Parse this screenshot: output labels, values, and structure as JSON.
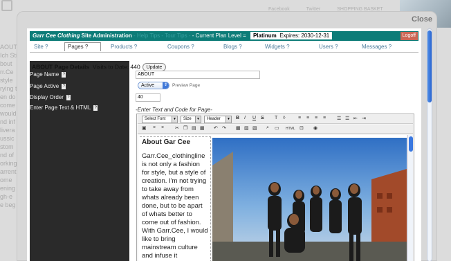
{
  "background": {
    "links": [
      "Facebook",
      "Twitter",
      "SHOPPING BASKET"
    ],
    "left_text": [
      "AOUT",
      "Ich Sti",
      "",
      "bout",
      "rr.Ce",
      "style",
      "rying t",
      "en do",
      "come",
      "would",
      "nd inf",
      "livera",
      "ussic",
      "stom",
      "nd of",
      "orking",
      "arrent",
      "ome",
      "ening",
      "gh-e",
      "e beg"
    ]
  },
  "modal": {
    "close_label": "Close"
  },
  "admin_bar": {
    "brand": "Garr Cee Clothing",
    "site_admin": " Site Administration",
    "muted_1": " - Help Tips -",
    "muted_2": " Tour Tips -",
    "plan_prefix": " - Current Plan Level = ",
    "plan_name": "Platinum",
    "expires": "Expires: 2030-12-31",
    "logoff": "Logoff"
  },
  "nav": {
    "tabs": [
      {
        "label": "Site ?"
      },
      {
        "label": "Pages ?"
      },
      {
        "label": "Products ?"
      },
      {
        "label": "Coupons ?"
      },
      {
        "label": "Blogs ?"
      },
      {
        "label": "Widgets ?"
      },
      {
        "label": "Users ?"
      },
      {
        "label": "Messages ?"
      }
    ]
  },
  "details": {
    "title": "ABOUT Page Details",
    "visits_label": "Visits to Date: 440",
    "update_label": "Update"
  },
  "form": {
    "page_name_label": "Page Name",
    "page_name_value": "ABOUT",
    "page_active_label": "Page Active",
    "page_active_value": "Active",
    "preview_label": "Preview Page",
    "display_order_label": "Display Order",
    "display_order_value": "40",
    "text_html_label": "Enter Page Text & HTML",
    "enter_text_label": "-Enter Text and Code for Page-",
    "help_glyph": "?"
  },
  "editor": {
    "font_select": "Select Font",
    "size_select": "Size",
    "header_select": "Header",
    "content_title": "About Gar Cee",
    "content_body": "Garr.Cee_clothingline is not only a fashion for style, but a style of creation. I'm not trying to take away from whats already been done, but to be apart of whats better to come out of fashion. With Garr.Cee, I would like to bring mainstream culture and infuse it"
  }
}
